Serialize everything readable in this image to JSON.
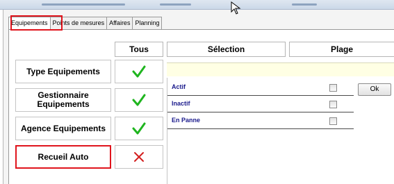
{
  "tabs": [
    {
      "label": "Equipements",
      "active": true
    },
    {
      "label": "Points de mesures",
      "active": false
    },
    {
      "label": "Affaires",
      "active": false
    },
    {
      "label": "Planning",
      "active": false
    }
  ],
  "columns": {
    "tous": "Tous",
    "selection": "Sélection",
    "plage": "Plage"
  },
  "rows": [
    {
      "label": "Type Equipements",
      "state": "check"
    },
    {
      "label": "Gestionnaire Equipements",
      "state": "check"
    },
    {
      "label": "Agence Equipements",
      "state": "check"
    },
    {
      "label": "Recueil Auto",
      "state": "cross"
    }
  ],
  "list": [
    {
      "label": "Actif",
      "checked": false
    },
    {
      "label": "Inactif",
      "checked": false
    },
    {
      "label": "En Panne",
      "checked": false
    }
  ],
  "ok_button": "Ok",
  "colors": {
    "highlight": "#e0141c",
    "check": "#1fb51f",
    "cross": "#d41f1f",
    "list_text": "#1a1a8c"
  }
}
